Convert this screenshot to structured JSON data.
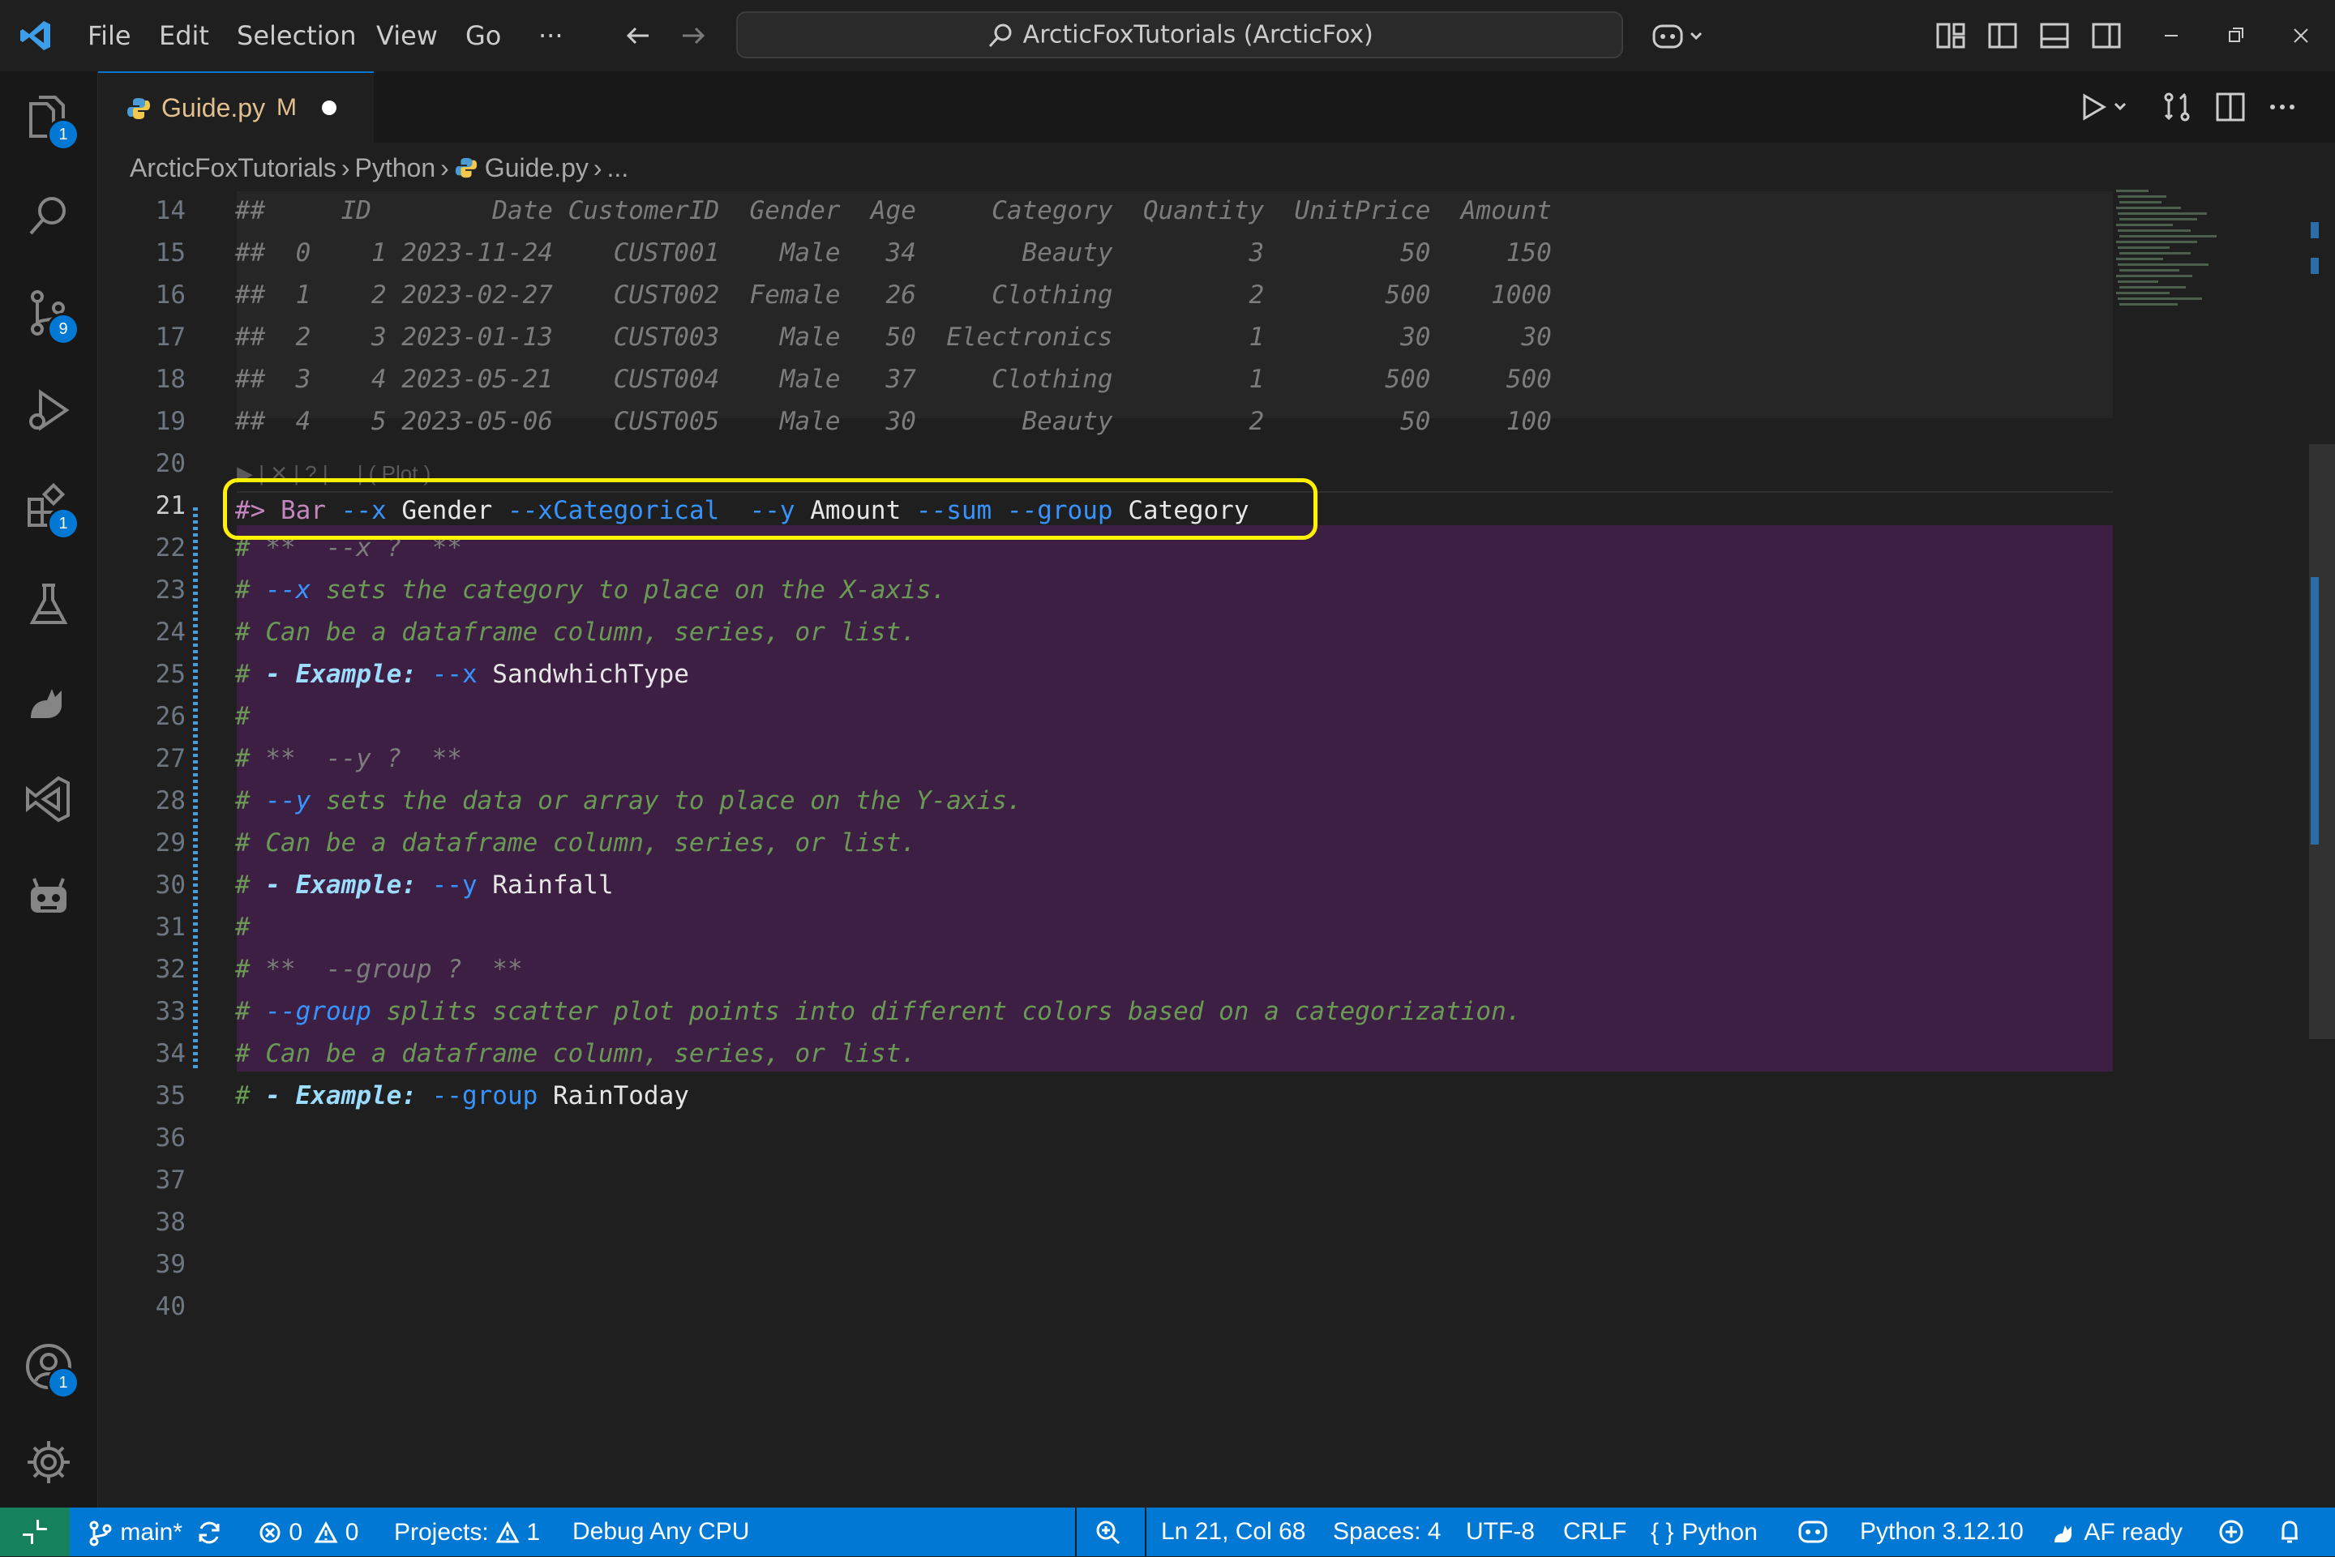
{
  "menu": {
    "file": "File",
    "edit": "Edit",
    "selection": "Selection",
    "view": "View",
    "go": "Go",
    "more": "···"
  },
  "search": {
    "text": "ArcticFoxTutorials (ArcticFox)"
  },
  "activity": {
    "explorer_badge": "1",
    "scm_badge": "9",
    "extensions_badge": "1",
    "accounts_badge": "1"
  },
  "tab": {
    "title": "Guide.py",
    "modified": "M"
  },
  "breadcrumb": {
    "items": [
      "ArcticFoxTutorials",
      "Python",
      "Guide.py",
      "..."
    ]
  },
  "editor": {
    "line_numbers": [
      "14",
      "15",
      "16",
      "17",
      "18",
      "19",
      "20",
      "21",
      "22",
      "23",
      "24",
      "25",
      "26",
      "27",
      "28",
      "29",
      "30",
      "31",
      "32",
      "33",
      "34",
      "35",
      "36",
      "37",
      "38",
      "39",
      "40"
    ],
    "table_lines": [
      "##     ID        Date CustomerID  Gender  Age     Category  Quantity  UnitPrice  Amount",
      "##  0    1 2023-11-24    CUST001    Male   34       Beauty         3         50     150",
      "##  1    2 2023-02-27    CUST002  Female   26     Clothing         2        500    1000",
      "##  2    3 2023-01-13    CUST003    Male   50  Electronics         1         30      30",
      "##  3    4 2023-05-21    CUST004    Male   37     Clothing         1        500     500",
      "##  4    5 2023-05-06    CUST005    Male   30       Beauty         2         50     100"
    ],
    "codelens": "▶ | ✕ | ? | ... | ( Plot )",
    "command": {
      "prefix": "#> ",
      "kw": "Bar",
      "f1": " --x ",
      "v1": "Gender",
      "f2": " --xCategorical  --y ",
      "v2": "Amount",
      "f3": " --sum --group ",
      "v3": "Category"
    },
    "doc": {
      "l22": [
        "# ",
        "**  --x ?  **"
      ],
      "l23": [
        "# ",
        "--x sets the category to place on the X-axis."
      ],
      "l24": [
        "# ",
        "Can be a dataframe column, series, or list."
      ],
      "l25": [
        "# ",
        "- Example: ",
        "--x ",
        "SandwhichType"
      ],
      "l26": [
        "#"
      ],
      "l27": [
        "# ",
        "**  --y ?  **"
      ],
      "l28": [
        "# ",
        "--y sets the data or array to place on the Y-axis."
      ],
      "l29": [
        "# ",
        "Can be a dataframe column, series, or list."
      ],
      "l30": [
        "# ",
        "- Example: ",
        "--y ",
        "Rainfall"
      ],
      "l31": [
        "#"
      ],
      "l32": [
        "# ",
        "**  --group ?  **"
      ],
      "l33": [
        "# ",
        "--group splits scatter plot points into different colors based on a categorization."
      ],
      "l34": [
        "# ",
        "Can be a dataframe column, series, or list."
      ],
      "l35": [
        "# ",
        "- Example: ",
        "--group ",
        "RainToday"
      ]
    }
  },
  "status": {
    "branch": "main*",
    "problems_errors": "0",
    "problems_warnings": "0",
    "projects": "Projects:",
    "projects_count": "1",
    "debug": "Debug Any CPU",
    "position": "Ln 21, Col 68",
    "spaces": "Spaces: 4",
    "encoding": "UTF-8",
    "eol": "CRLF",
    "language": "Python",
    "interpreter": "Python 3.12.10",
    "af": "AF ready"
  },
  "colors": {
    "accent": "#0078d4",
    "highlight": "#fff200",
    "cell_bg": "#3c1f42",
    "remote": "#16825d"
  }
}
